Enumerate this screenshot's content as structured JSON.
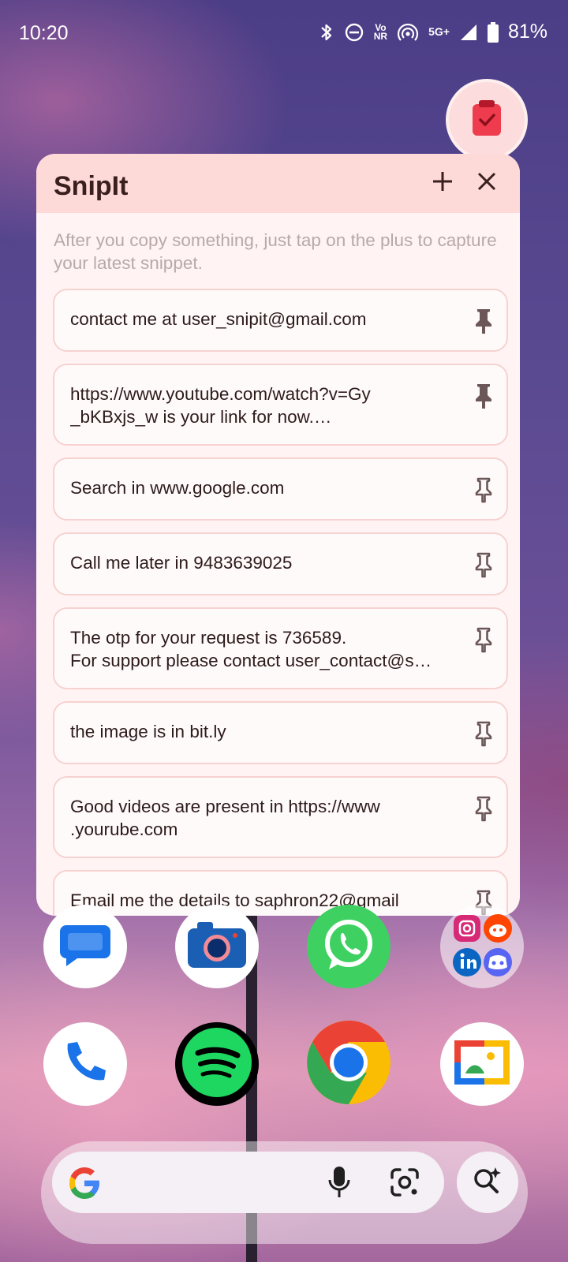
{
  "status_bar": {
    "time": "10:20",
    "volte_top": "Vo",
    "volte_bottom": "NR",
    "network_label": "5G+",
    "battery": "81%"
  },
  "snipit": {
    "title": "SnipIt",
    "add_icon": "plus-icon",
    "close_icon": "close-icon",
    "hint": "After you copy something, just tap on the plus to capture your latest snippet.",
    "snippets": [
      {
        "lines": [
          "contact me at user_snipit@gmail.com"
        ],
        "pinned": true
      },
      {
        "lines": [
          "https://www.youtube.com/watch?v=Gy",
          "_bKBxjs_w is your link for now.…"
        ],
        "pinned": true
      },
      {
        "lines": [
          "Search in www.google.com"
        ],
        "pinned": false
      },
      {
        "lines": [
          "Call me later in 9483639025"
        ],
        "pinned": false
      },
      {
        "lines": [
          "The otp for your request is 736589.",
          "For support please contact user_contact@s…"
        ],
        "pinned": false
      },
      {
        "lines": [
          "the image is in bit.ly"
        ],
        "pinned": false
      },
      {
        "lines": [
          "Good videos are present in https://www",
          ".yourube.com"
        ],
        "pinned": false
      },
      {
        "lines": [
          "Email me the details to saphron22@gmail"
        ],
        "pinned": false
      }
    ]
  },
  "home": {
    "apps_row1": [
      "messages-app",
      "camera-app",
      "whatsapp-app",
      "social-folder"
    ],
    "apps_row2": [
      "phone-app",
      "spotify-app",
      "chrome-app",
      "gallery-app"
    ],
    "search_icons": [
      "google-icon",
      "mic-icon",
      "lens-icon",
      "ai-search-icon"
    ]
  },
  "colors": {
    "panel_header": "#fdd9d8",
    "panel_bg": "#fff4f3",
    "item_border": "#f6d2d0",
    "accent_red": "#ee3b4d"
  }
}
